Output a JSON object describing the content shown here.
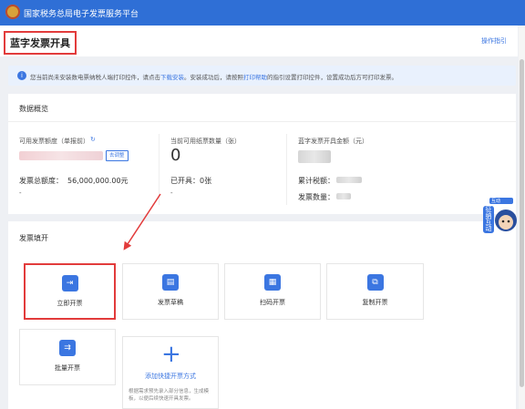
{
  "app": {
    "title": "国家税务总局电子发票服务平台"
  },
  "page": {
    "title": "蓝字发票开具",
    "guide_link": "操作指引"
  },
  "notice": {
    "prefix": "您当前尚未安装数电票纳税人端打印控件，请点击",
    "download_link": "下载安装",
    "middle": "。安装成功后，请按照",
    "help_link": "打印帮助",
    "suffix": "的指引设置打印控件，设置成功后方可打印发票。"
  },
  "overview": {
    "title": "数据概览",
    "quota_label": "可用发票额度（单报前）",
    "quota_button": "去调整",
    "total_quota_label": "发票总额度：",
    "total_quota_value": "56,000,000.00元",
    "dash1": "-",
    "paper_label": "当前可用纸票数量（张）",
    "paper_value": "0",
    "issued_label": "已开具：",
    "issued_value": "0张",
    "dash2": "-",
    "amount_label": "蓝字发票开具金额（元）",
    "tax_label": "累计税额：",
    "count_label": "发票数量："
  },
  "entry": {
    "title": "发票填开",
    "cards": [
      {
        "label": "立即开票",
        "icon": "invoice-scan-icon"
      },
      {
        "label": "发票草稿",
        "icon": "draft-icon"
      },
      {
        "label": "扫码开票",
        "icon": "qrcode-icon"
      },
      {
        "label": "复制开票",
        "icon": "copy-icon"
      },
      {
        "label": "批量开票",
        "icon": "batch-icon"
      }
    ],
    "add_label": "添加快捷开票方式",
    "add_desc": "根据需求预先录入部分信息，生成模板，以便后续快速开具发票。"
  },
  "mascot": {
    "badge": "互动",
    "text": "征纳互动"
  },
  "colors": {
    "primary": "#2f6fd6",
    "accent": "#3b76e1",
    "highlight": "#e23b3b"
  }
}
